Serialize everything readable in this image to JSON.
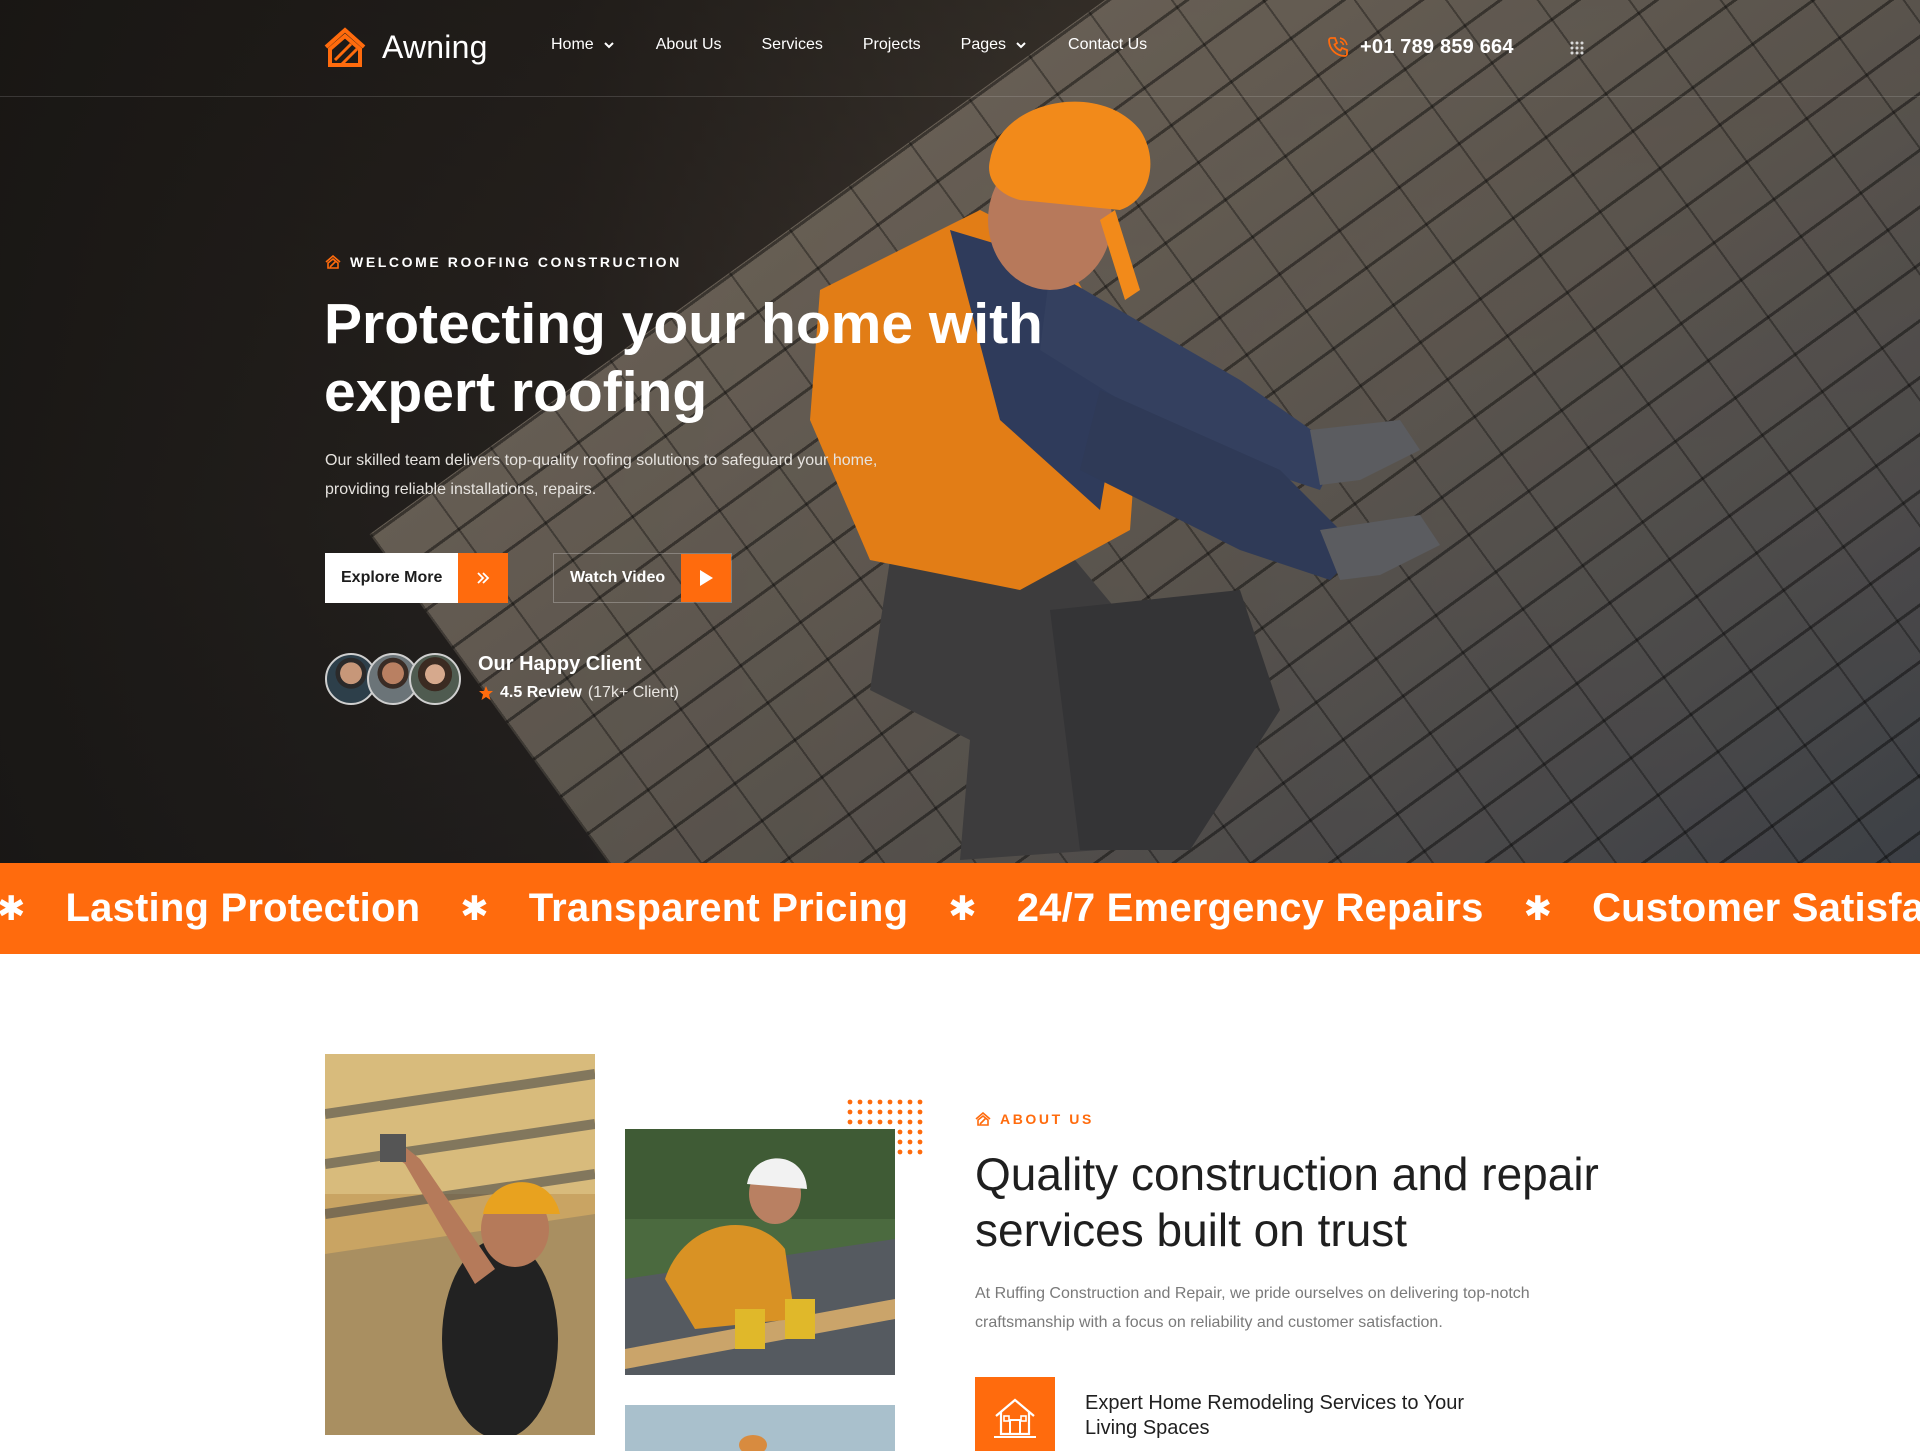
{
  "brand": {
    "name": "Awning",
    "accent": "#ff6b0d"
  },
  "nav": {
    "items": [
      {
        "label": "Home",
        "dropdown": true
      },
      {
        "label": "About Us",
        "dropdown": false
      },
      {
        "label": "Services",
        "dropdown": false
      },
      {
        "label": "Projects",
        "dropdown": false
      },
      {
        "label": "Pages",
        "dropdown": true
      },
      {
        "label": "Contact Us",
        "dropdown": false
      }
    ],
    "phone": "+01 789 859 664"
  },
  "hero": {
    "tagline": "WELCOME ROOFING CONSTRUCTION",
    "title": "Protecting your home with expert roofing",
    "description": "Our skilled team delivers top-quality roofing solutions to safeguard your home, providing reliable installations, repairs.",
    "explore_label": "Explore More",
    "watch_label": "Watch Video",
    "client_title": "Our Happy Client",
    "rating_value": "4.5 Review",
    "rating_count": "(17k+ Client)"
  },
  "marquee": {
    "items": [
      "Lasting Protection",
      "Transparent Pricing",
      "24/7 Emergency Repairs",
      "Customer Satisfac"
    ]
  },
  "about": {
    "tagline": "ABOUT US",
    "title": "Quality construction and repair services built on trust",
    "description": "At Ruffing Construction and Repair, we pride ourselves on delivering top-notch craftsmanship with a focus on reliability and customer satisfaction.",
    "feature_title": "Expert Home Remodeling Services to Your Living Spaces"
  }
}
